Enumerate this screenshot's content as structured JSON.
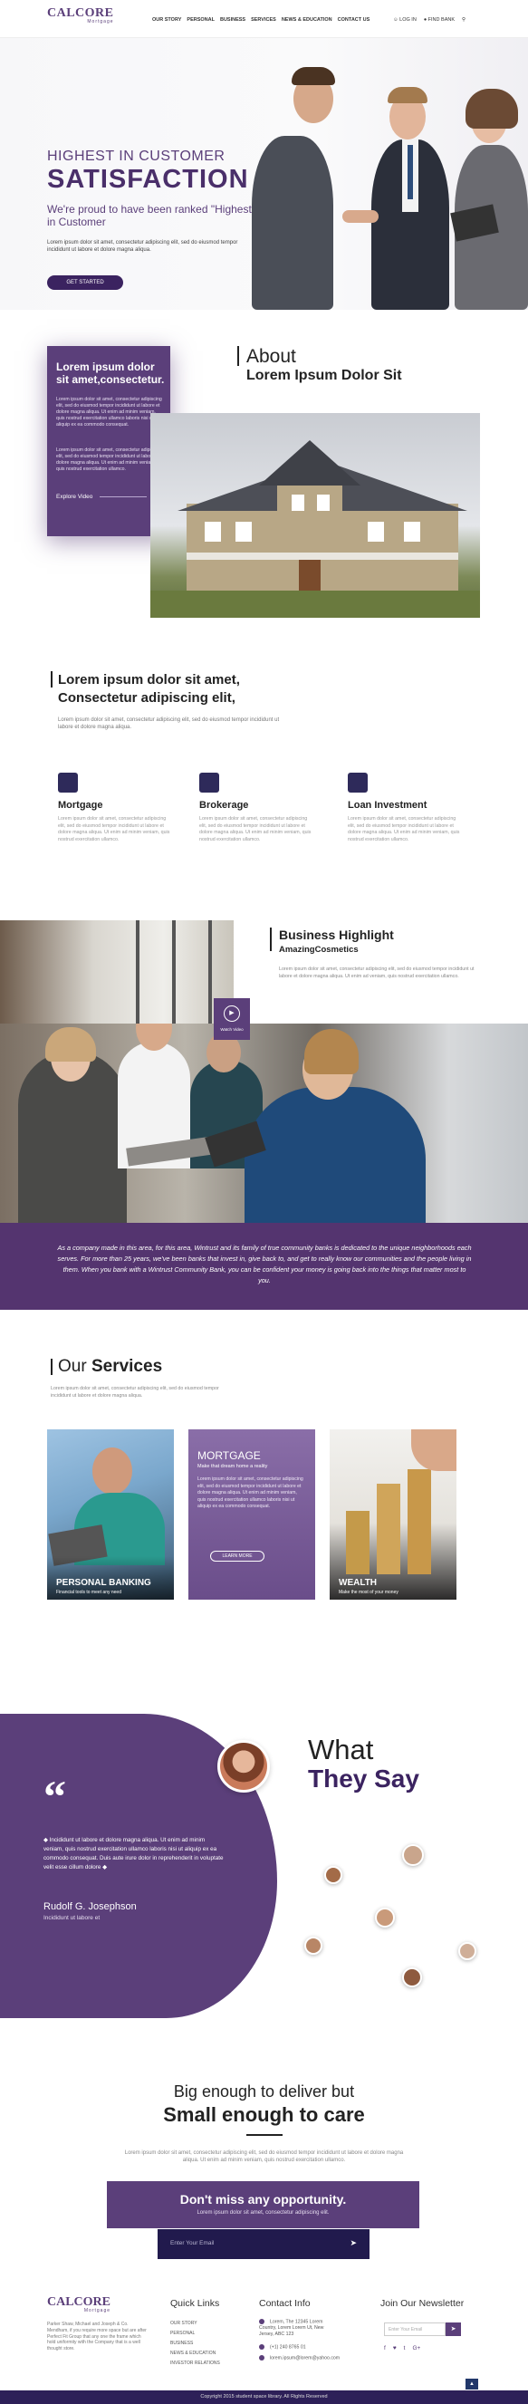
{
  "brand": {
    "logo_main": "CALCORE",
    "logo_sub": "Mortgage"
  },
  "nav": {
    "items": [
      "OUR STORY",
      "PERSONAL",
      "BUSINESS",
      "SERVICES",
      "NEWS & EDUCATION",
      "CONTACT US"
    ],
    "login": "LOG IN",
    "find_bank": "FIND BANK"
  },
  "hero": {
    "line1": "HIGHEST IN CUSTOMER",
    "line2": "SATISFACTION",
    "line3": "We're proud to have been ranked \"Highest in Customer",
    "body": "Lorem ipsum dolor sit amet, consectetur adipiscing elit, sed do eiusmod tempor incididunt ut labore et dolore magna aliqua.",
    "button": "GET STARTED"
  },
  "about": {
    "box_title": "Lorem ipsum dolor sit amet,consectetur.",
    "box_p1": "Lorem ipsum dolor sit amet, consectetur adipiscing elit, sed do eiusmod tempor incididunt ut labore et dolore magna aliqua. Ut enim ad minim veniam, quis nostrud exercitation ullamco laboris nisi ut aliquip ex ea commodo consequat.",
    "box_p2": "Lorem ipsum dolor sit amet, consectetur adipiscing elit, sed do eiusmod tempor incididunt ut labore et dolore magna aliqua. Ut enim ad minim veniam, quis nostrud exercitation ullamco.",
    "explore": "Explore Video",
    "heading1": "About",
    "heading2": "Lorem Ipsum Dolor Sit"
  },
  "intro": {
    "heading": "Lorem ipsum dolor sit amet, Consectetur adipiscing elit,",
    "body": "Lorem ipsum dolor sit amet, consectetur adipiscing elit, sed do eiusmod tempor incididunt ut labore et dolore magna aliqua."
  },
  "features": [
    {
      "title": "Mortgage",
      "desc": "Lorem ipsum dolor sit amet, consectetur adipiscing elit, sed do eiusmod tempor incididunt ut labore et dolore magna aliqua. Ut enim ad minim veniam, quis nostrud exercitation ullamco."
    },
    {
      "title": "Brokerage",
      "desc": "Lorem ipsum dolor sit amet, consectetur adipiscing elit, sed do eiusmod tempor incididunt ut labore et dolore magna aliqua. Ut enim ad minim veniam, quis nostrud exercitation ullamco."
    },
    {
      "title": "Loan Investment",
      "desc": "Lorem ipsum dolor sit amet, consectetur adipiscing elit, sed do eiusmod tempor incididunt ut labore et dolore magna aliqua. Ut enim ad minim veniam, quis nostrud exercitation ullamco."
    }
  ],
  "business": {
    "title": "Business Highlight",
    "subtitle": "AmazingCosmetics",
    "body": "Lorem ipsum dolor sit amet, consectetur adipiscing elit, sed do eiusmod tempor incididunt ut labore et dolore magna aliqua. Ut enim ad veniam, quis nostrud exercitation ullamco.",
    "watch": "Watch Video",
    "quote": "As a company made in this area, for this area, Wintrust and its family of true community banks is dedicated to the unique neighborhoods each serves. For more than 25 years, we've been banks that invest in, give back to, and get to really know our communities and the people living in them. When you bank with a Wintrust Community Bank, you can be confident your money is going back into the things that matter most to you."
  },
  "services": {
    "heading_a": "Our ",
    "heading_b": "Services",
    "body": "Lorem ipsum dolor sit amet, consectetur adipiscing elit, sed do eiusmod tempor incididunt ut labore et dolore magna aliqua.",
    "cards": [
      {
        "title": "PERSONAL BANKING",
        "sub": "Financial tools to meet any need"
      },
      {
        "title": "MORTGAGE",
        "sub": "Make that dream home a reality",
        "body": "Lorem ipsum dolor sit amet, consectetur adipiscing elit, sed do eiusmod tempor incididunt ut labore et dolore magna aliqua. Ut enim ad minim veniam, quis nostrud exercitation ullamco laboris nisi ut aliquip ex ea commodo consequat.",
        "button": "LEARN MORE"
      },
      {
        "title": "WEALTH",
        "sub": "Make the most of your money"
      }
    ]
  },
  "testimonials": {
    "what": "What",
    "they_say": "They Say",
    "quote_mark": "“",
    "text": "◆ Incididunt ut labore et dolore magna aliqua. Ut enim ad minim veniam, quis nostrud exercitation ullamco laboris nisi ut aliquip ex ea commodo consequat. Duis aute irure dolor in reprehenderit in voluptate velit esse cillum dolore ◆",
    "name": "Rudolf G. Josephson",
    "role": "Incididunt ut labore et"
  },
  "big": {
    "line1": "Big enough to deliver but",
    "line2": "Small enough to care",
    "body": "Lorem ipsum dolor sit amet, consectetur adipiscing elit, sed do eiusmod tempor incididunt ut labore et dolore magna aliqua. Ut enim ad minim veniam, quis nostrud exercitation ullamco.",
    "cta_title": "Don't miss any opportunity.",
    "cta_sub": "Lorem ipsum dolor sit amet, consectetur adipiscing elit.",
    "email_placeholder": "Enter Your Email",
    "arrow": "➤"
  },
  "footer": {
    "desc": "Parker Shaw, Michael and Joseph & Co. Mendham, if you require more space but are after Perfect Fit Group that any one the frame which hold uniformity with the Company that is a well thought store.",
    "quick_title": "Quick Links",
    "links": [
      "OUR STORY",
      "PERSONAL",
      "BUSINESS",
      "NEWS & EDUCATION",
      "INVESTOR RELATIONS"
    ],
    "contact_title": "Contact Info",
    "address": "Lorem, The 12345 Lorem Country, Lorem Lorem Ut, New Jersey, ABC 123",
    "phone": "(+1) 240 8765 01",
    "email": "lorem.ipsum@lorem@yahoo.com",
    "newsletter_title": "Join Our Newsletter",
    "news_placeholder": "Enter Your Email",
    "social": [
      "f",
      "♥",
      "t",
      "G+"
    ],
    "copyright": "Copyright 2015 student space library. All Rights Reserved"
  }
}
